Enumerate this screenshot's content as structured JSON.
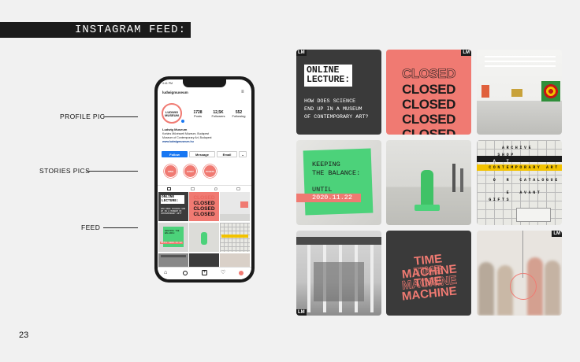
{
  "header": {
    "title": "INSTAGRAM FEED:"
  },
  "annotations": {
    "profile_pic": "PROFILE PIC",
    "stories_pics": "STORIES PICS",
    "feed": "FEED"
  },
  "page_number": "23",
  "colors": {
    "coral": "#f07a72",
    "green": "#4cd27a",
    "dark": "#3b3b3b",
    "accent_yellow": "#f2c200"
  },
  "phone": {
    "status_time": "4:41 PM",
    "username": "ludwigmuseum",
    "avatar_text": "LUDWIG MUSEUM",
    "stats": [
      {
        "value": "1728",
        "label": "Posts"
      },
      {
        "value": "12,5K",
        "label": "Followers"
      },
      {
        "value": "552",
        "label": "Following"
      }
    ],
    "bio": {
      "name": "Ludwig Museum",
      "line1": "Kortárs Művészeti Múzeum, Budapest",
      "line2": "Museum of Contemporary Art, Budapest",
      "link": "www.ludwigmuseum.hu"
    },
    "buttons": {
      "follow": "Follow",
      "message": "Message",
      "email": "Email"
    },
    "stories": [
      "OPEN HOURS",
      "EVENT",
      "TICKETS"
    ],
    "mini_feed": {
      "online": "ONLINE LECTURE:",
      "question": "HOW DOES SCIENCE END UP IN A MUSEUM OF CONTEMPORARY ART?",
      "closed": "CLOSED",
      "keeping": "KEEPING THE BALANCE:",
      "until": "UNTIL 2020.11.22"
    }
  },
  "feed": {
    "logo": "LM",
    "tile1": {
      "title_line1": "ONLINE",
      "title_line2": "LECTURE:",
      "body_line1": "HOW DOES SCIENCE",
      "body_line2": "END UP IN A MUSEUM",
      "body_line3": "OF CONTEMPORARY ART?"
    },
    "tile2": {
      "word": "CLOSED"
    },
    "tile4": {
      "line1": "KEEPING",
      "line2": "THE BALANCE:",
      "until": "UNTIL",
      "date": "2020.11.22"
    },
    "tile6": {
      "row1": "     ARCHIVE",
      "row2": "    SHOP",
      "row3": "   A  T",
      "row4": "  CONTEMPORARY ART",
      "row5": "   O  R  CATALOGUE",
      "row6": "      E  AVANT",
      "row7": "  GIFTS"
    },
    "tile8": {
      "word": "TIME MACHINE"
    }
  }
}
